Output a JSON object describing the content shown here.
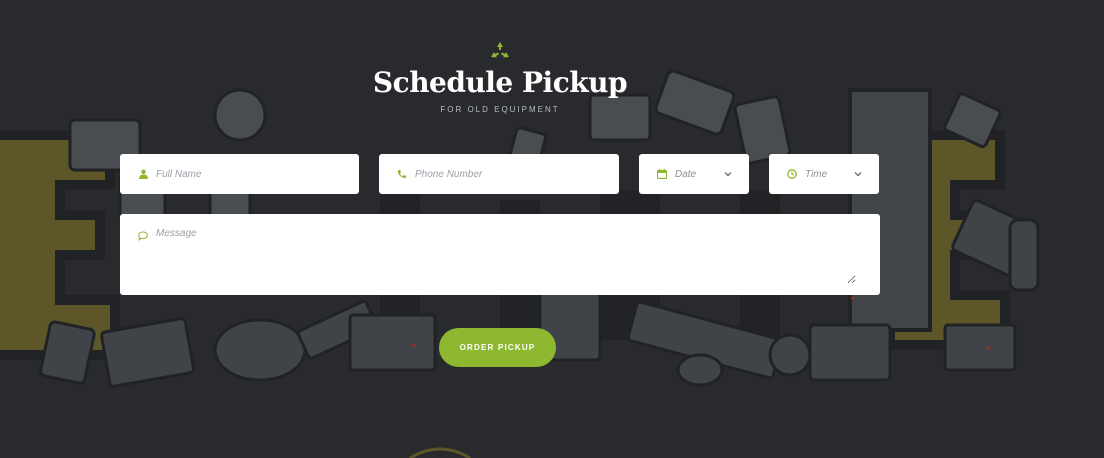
{
  "header": {
    "icon": "recycle-icon",
    "title": "Schedule Pickup",
    "subtitle": "FOR OLD EQUIPMENT"
  },
  "form": {
    "full_name": {
      "placeholder": "Full Name",
      "icon": "user-icon"
    },
    "phone": {
      "placeholder": "Phone Number",
      "icon": "phone-icon"
    },
    "date": {
      "value": "Date",
      "icon": "calendar-icon"
    },
    "time": {
      "value": "Time",
      "icon": "clock-icon"
    },
    "message": {
      "placeholder": "Message",
      "icon": "chat-bubble-icon"
    },
    "submit_label": "ORDER PICKUP"
  },
  "colors": {
    "accent": "#8eb82f",
    "background": "#2b2d30",
    "title": "#ffffff"
  }
}
